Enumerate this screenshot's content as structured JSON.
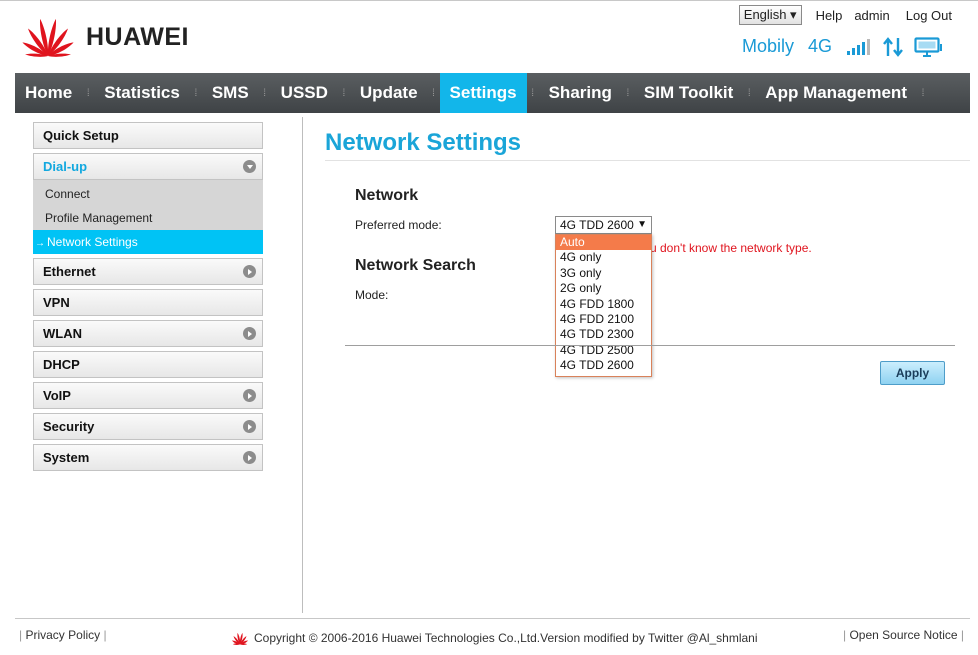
{
  "header": {
    "brand": "HUAWEI",
    "language": "English",
    "help": "Help",
    "user": "admin",
    "logout": "Log Out",
    "carrier": "Mobily",
    "network": "4G"
  },
  "nav": {
    "items": [
      "Home",
      "Statistics",
      "SMS",
      "USSD",
      "Update",
      "Settings",
      "Sharing",
      "SIM Toolkit",
      "App Management"
    ],
    "active": "Settings"
  },
  "sidebar": {
    "quick_setup": "Quick Setup",
    "dialup": "Dial-up",
    "dialup_sub": [
      "Connect",
      "Profile Management",
      "Network Settings"
    ],
    "ethernet": "Ethernet",
    "vpn": "VPN",
    "wlan": "WLAN",
    "dhcp": "DHCP",
    "voip": "VoIP",
    "security": "Security",
    "system": "System"
  },
  "main": {
    "title": "Network Settings",
    "network_heading": "Network",
    "preferred_label": "Preferred mode:",
    "preferred_value": "4G TDD 2600",
    "hint": "u don't know the network type.",
    "search_heading": "Network Search",
    "mode_label": "Mode:",
    "options": [
      "Auto",
      "4G only",
      "3G only",
      "2G only",
      "4G FDD 1800",
      "4G FDD 2100",
      "4G TDD 2300",
      "4G TDD 2500",
      "4G TDD 2600"
    ],
    "highlighted_option": "Auto",
    "apply": "Apply"
  },
  "footer": {
    "privacy": "Privacy Policy",
    "copyright": "Copyright © 2006-2016 Huawei Technologies Co.,Ltd.Version modified by Twitter @Al_shmlani",
    "open_source": "Open Source Notice"
  },
  "colors": {
    "accent": "#12b6ea",
    "title": "#1aa5d8",
    "nav_bg": "#4a4e51",
    "hint": "#e0141e",
    "dropdown_highlight": "#f47b4a",
    "brand_red": "#e0141e"
  }
}
